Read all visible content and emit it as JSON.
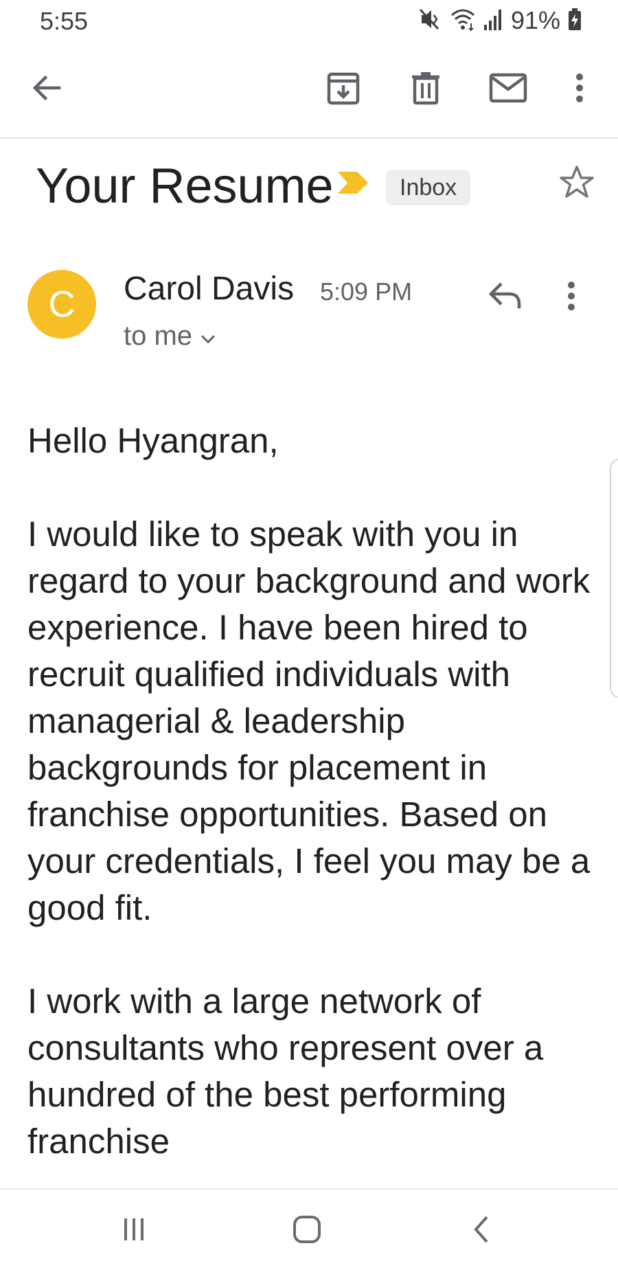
{
  "status_bar": {
    "time": "5:55",
    "battery": "91%",
    "icons": [
      "mute-icon",
      "wifi-icon",
      "signal-icon",
      "battery-charging-icon"
    ]
  },
  "toolbar": {
    "icons": [
      "back-arrow-icon",
      "archive-icon",
      "delete-icon",
      "mark-unread-icon",
      "more-vert-icon"
    ]
  },
  "email": {
    "subject": "Your Resume",
    "label": "Inbox",
    "sender": {
      "initial": "C",
      "name": "Carol Davis",
      "time": "5:09 PM",
      "recipient": "to me"
    },
    "body": [
      "Hello Hyangran,",
      "I would like to speak with you in regard to your background and work experience. I have been hired to recruit qualified individuals with managerial & leadership backgrounds for placement in franchise opportunities. Based on your credentials, I feel you may be a good fit.",
      "I work with a large network of consultants who represent over a hundred of the best performing franchise"
    ]
  },
  "nav_bar": {
    "icons": [
      "recent-apps-icon",
      "home-icon",
      "back-icon"
    ]
  },
  "colors": {
    "avatar": "#f6bf26",
    "importance_marker": "#f6bf26",
    "chip_background": "#eeeeee",
    "text_primary": "#202124",
    "text_secondary": "#5f6368"
  }
}
